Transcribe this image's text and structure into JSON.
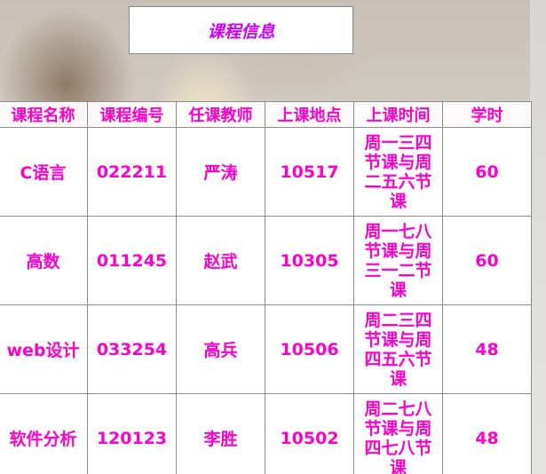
{
  "page": {
    "title": "课程信息"
  },
  "table": {
    "headers": [
      "课程名称",
      "课程编号",
      "任课教师",
      "上课地点",
      "上课时间",
      "学时"
    ],
    "rows": [
      {
        "name": "C语言",
        "code": "022211",
        "teacher": "严涛",
        "location": "10517",
        "time": "周一三四节课与周二五六节课",
        "hours": "60"
      },
      {
        "name": "高数",
        "code": "011245",
        "teacher": "赵武",
        "location": "10305",
        "time": "周一七八节课与周三一二节课",
        "hours": "60"
      },
      {
        "name": "web设计",
        "code": "033254",
        "teacher": "高兵",
        "location": "10506",
        "time": "周二三四节课与周四五六节课",
        "hours": "48"
      },
      {
        "name": "软件分析",
        "code": "120123",
        "teacher": "李胜",
        "location": "10502",
        "time": "周二七八节课与周四七八节课",
        "hours": "48"
      }
    ]
  },
  "colors": {
    "title_text": "#cc00ff",
    "table_text": "#ff00cc",
    "border": "#8c8c8c"
  }
}
